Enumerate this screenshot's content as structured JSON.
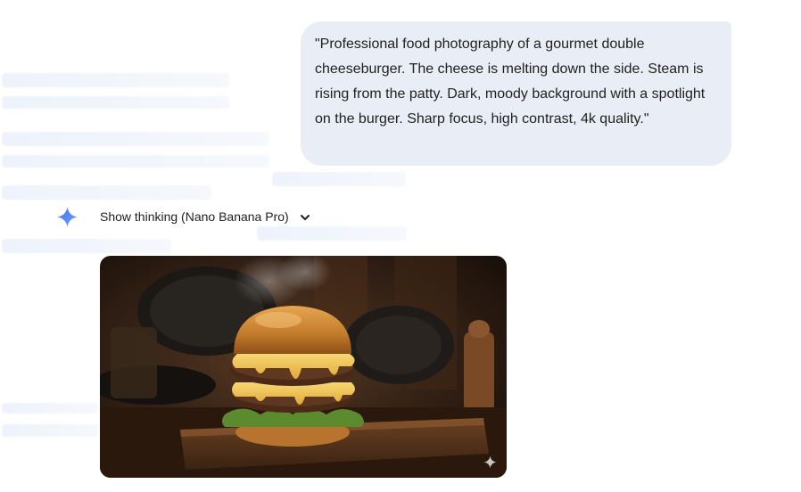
{
  "conversation": {
    "user_message": {
      "text": "\"Professional food photography of a gourmet double cheeseburger. The cheese is melting down the side. Steam is rising from the patty. Dark, moody background with a spotlight on the burger. Sharp focus, high contrast, 4k quality.\""
    },
    "response": {
      "thinking_label": "Show thinking (Nano Banana Pro)",
      "thinking_icon": "gemini-sparkle-icon",
      "toggle_icon": "chevron-down-icon",
      "generated_image": {
        "subject": "double cheeseburger on wooden board, dark kitchen background",
        "badge_icon": "sparkle-icon"
      }
    }
  },
  "colors": {
    "bubble_bg": "#e9eef6",
    "text": "#1f1f1f",
    "ghost_text": "#dde6f6",
    "gemini_blue": "#4a7fe8"
  }
}
